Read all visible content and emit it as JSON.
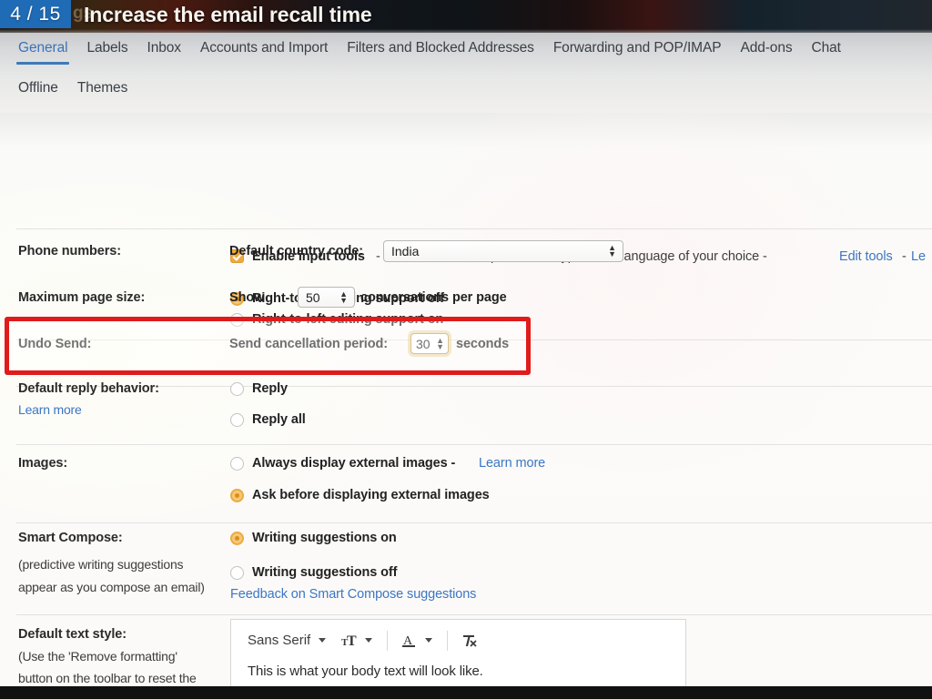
{
  "banner": {
    "badge": "4 / 15",
    "title": "Increase the email recall time",
    "ghost_text": "gs"
  },
  "tabs": {
    "row1": [
      {
        "label": "General",
        "active": true
      },
      {
        "label": "Labels",
        "active": false
      },
      {
        "label": "Inbox",
        "active": false
      },
      {
        "label": "Accounts and Import",
        "active": false
      },
      {
        "label": "Filters and Blocked Addresses",
        "active": false
      },
      {
        "label": "Forwarding and POP/IMAP",
        "active": false
      },
      {
        "label": "Add-ons",
        "active": false
      },
      {
        "label": "Chat",
        "active": false
      }
    ],
    "row2": [
      {
        "label": "Offline",
        "active": false
      },
      {
        "label": "Themes",
        "active": false
      }
    ]
  },
  "settings": {
    "input_tools": {
      "checkbox_checked": true,
      "label": "Enable input tools",
      "description": "- Use various text input tools to type in the language of your choice -",
      "edit_link": "Edit tools",
      "separator": "-",
      "learn_link_truncated": "Le"
    },
    "rtl": {
      "off_label": "Right-to-left editing support off",
      "off_selected": true,
      "on_label": "Right-to-left editing support on",
      "on_selected": false
    },
    "phone_numbers": {
      "label": "Phone numbers:",
      "field_label": "Default country code:",
      "value": "India"
    },
    "max_page_size": {
      "label": "Maximum page size:",
      "show_label": "Show",
      "value": "50",
      "suffix": "conversations per page"
    },
    "undo_send": {
      "label": "Undo Send:",
      "field_label": "Send cancellation period:",
      "value": "30",
      "suffix": "seconds",
      "highlighted": true,
      "highlight_color": "#e01b1b"
    },
    "default_reply": {
      "label": "Default reply behavior:",
      "learn_more": "Learn more",
      "reply_label": "Reply",
      "reply_selected": false,
      "reply_all_label": "Reply all",
      "reply_all_selected": false
    },
    "images": {
      "label": "Images:",
      "always_label": "Always display external images -",
      "always_learn_more": "Learn more",
      "always_selected": false,
      "ask_label": "Ask before displaying external images",
      "ask_selected": true
    },
    "smart_compose": {
      "label": "Smart Compose:",
      "note_line1": "(predictive writing suggestions",
      "note_line2": "appear as you compose an email)",
      "on_label": "Writing suggestions on",
      "on_selected": true,
      "off_label": "Writing suggestions off",
      "off_selected": false,
      "feedback_link": "Feedback on Smart Compose suggestions"
    },
    "default_text_style": {
      "label": "Default text style:",
      "note_line1": "(Use the 'Remove formatting'",
      "note_line2": "button on the toolbar to reset the",
      "font_name": "Sans Serif",
      "icons": [
        "font-size-icon",
        "text-color-icon",
        "remove-formatting-icon"
      ],
      "preview_text": "This is what your body text will look like."
    }
  },
  "colors": {
    "accent_amber": "#eeaa3f",
    "link_blue": "#3b76c4",
    "tab_active_blue": "#3d7ab8",
    "badge_blue": "#1f6bb5",
    "highlight_red": "#e01b1b"
  }
}
